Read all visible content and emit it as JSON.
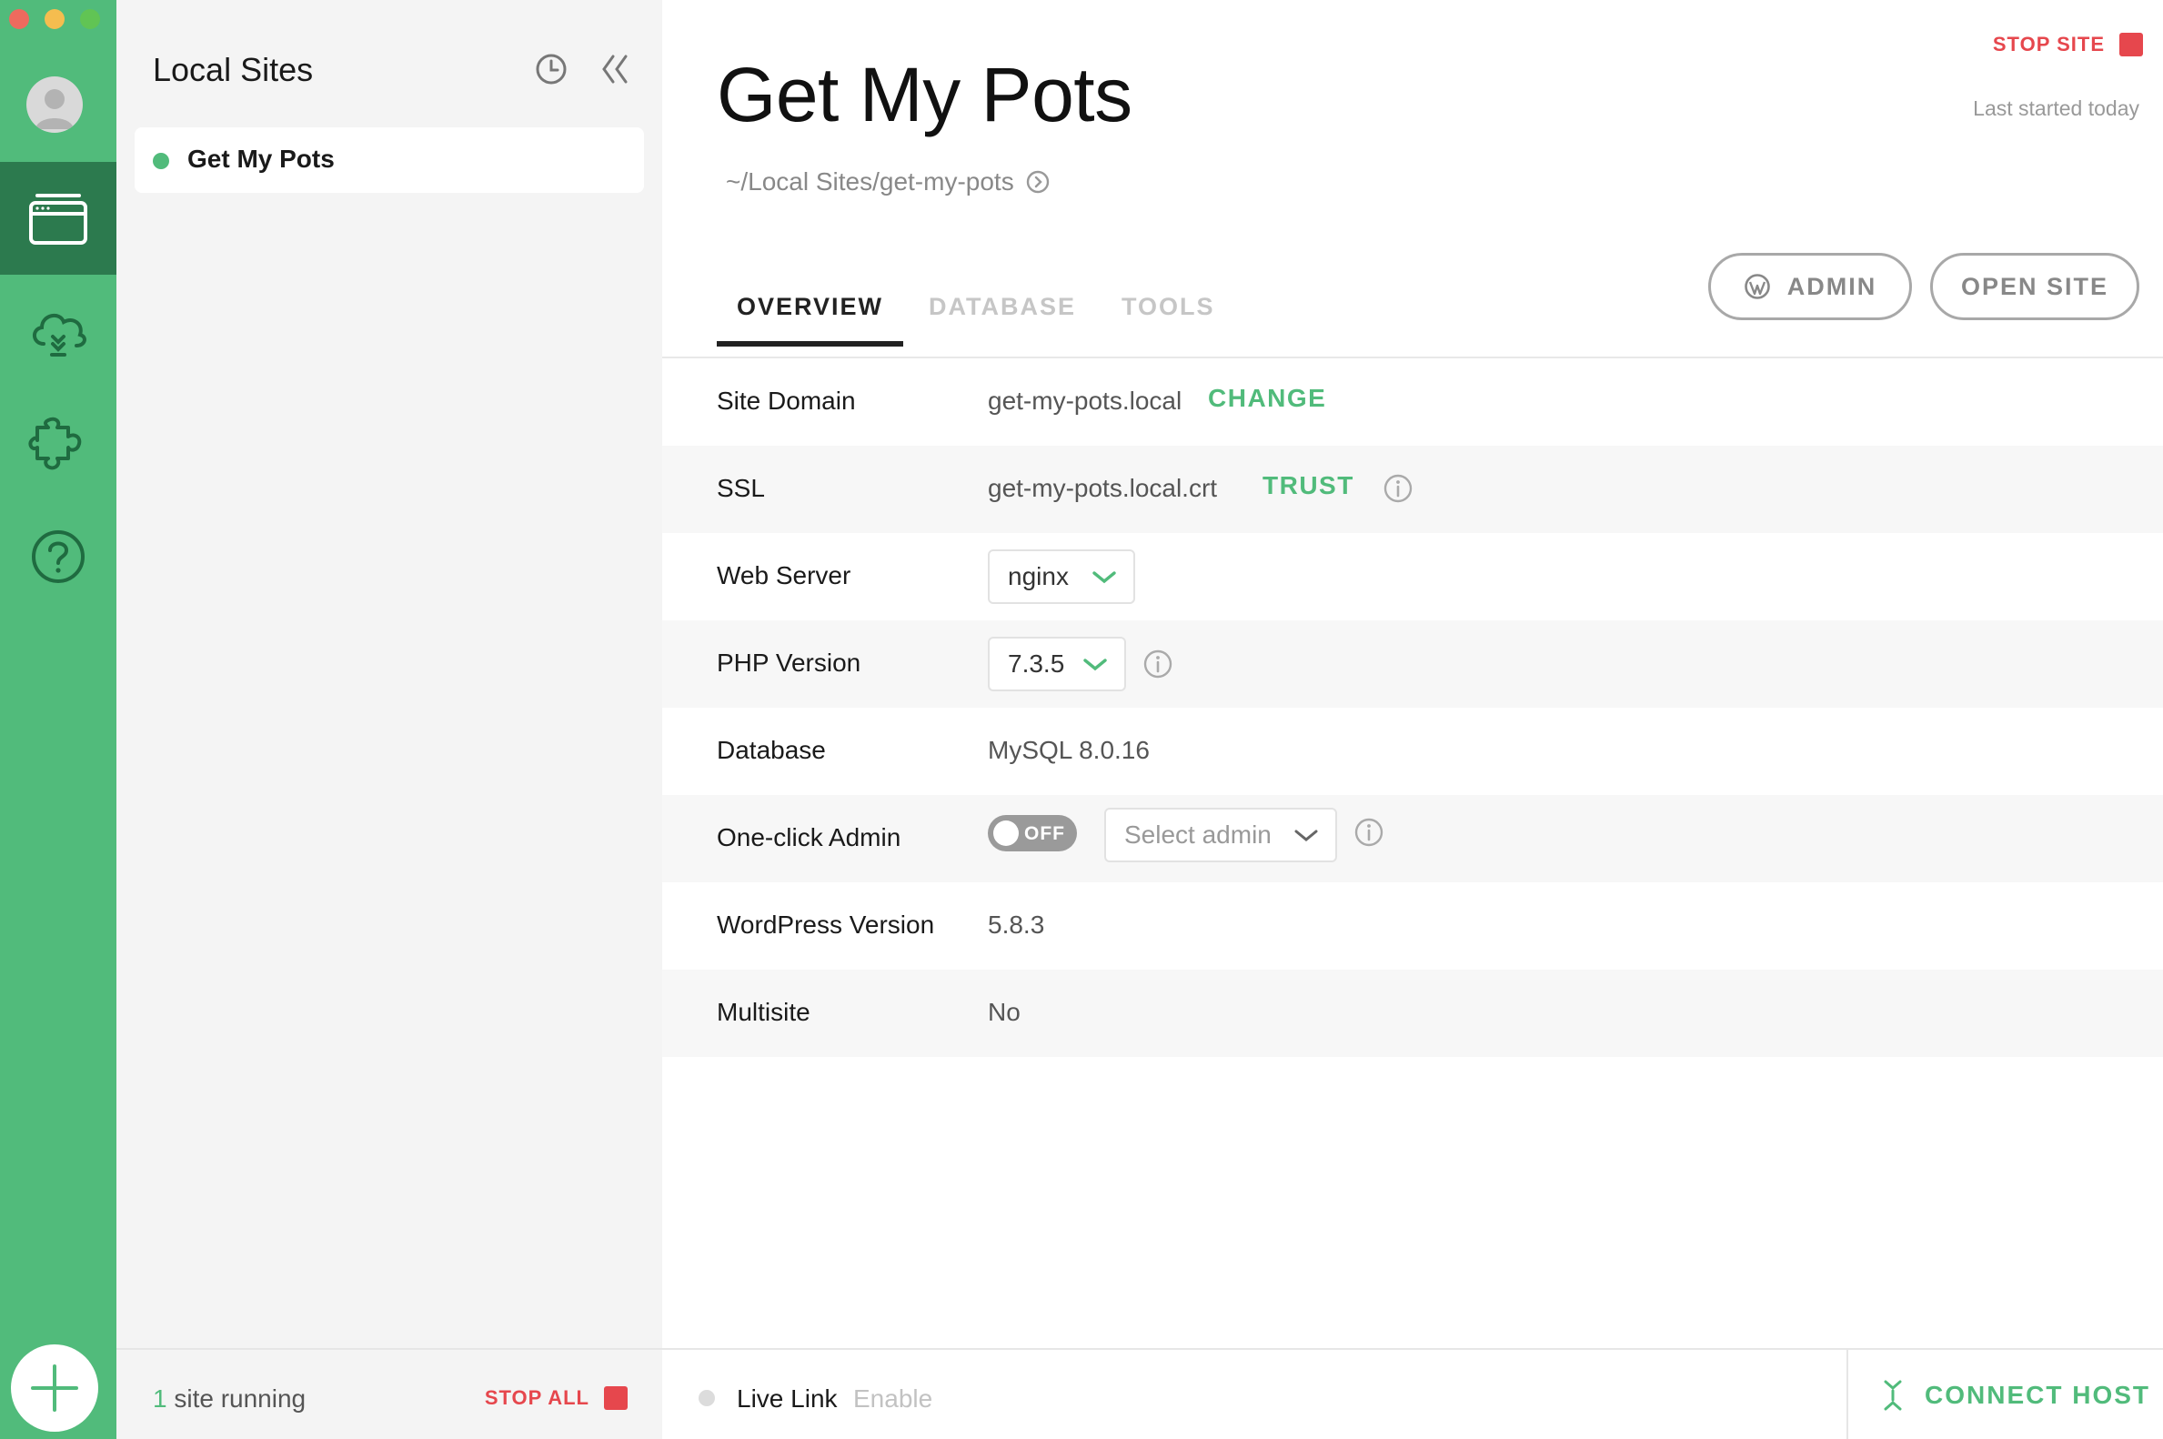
{
  "sidebar": {
    "title": "Local Sites",
    "history_icon": "clock-icon",
    "collapse_icon": "double-chevron-left-icon",
    "sites": [
      {
        "name": "Get My Pots",
        "status": "running"
      }
    ],
    "footer": {
      "count": "1",
      "running_text": "site running",
      "stop_all_label": "STOP ALL"
    }
  },
  "rail": {
    "items": [
      "avatar",
      "sites-icon",
      "cloud-icon",
      "addons-icon",
      "help-icon"
    ],
    "add_icon": "plus-icon"
  },
  "site": {
    "title": "Get My Pots",
    "path": "~/Local Sites/get-my-pots",
    "stop_site_label": "STOP SITE",
    "last_started": "Last started today",
    "admin_label": "ADMIN",
    "open_site_label": "OPEN SITE"
  },
  "tabs": [
    {
      "label": "OVERVIEW",
      "active": true
    },
    {
      "label": "DATABASE",
      "active": false
    },
    {
      "label": "TOOLS",
      "active": false
    }
  ],
  "overview": {
    "site_domain": {
      "label": "Site Domain",
      "value": "get-my-pots.local",
      "action": "CHANGE"
    },
    "ssl": {
      "label": "SSL",
      "value": "get-my-pots.local.crt",
      "action": "TRUST"
    },
    "web_server": {
      "label": "Web Server",
      "value": "nginx"
    },
    "php_version": {
      "label": "PHP Version",
      "value": "7.3.5"
    },
    "database": {
      "label": "Database",
      "value": "MySQL 8.0.16"
    },
    "one_click_admin": {
      "label": "One-click Admin",
      "toggle": "OFF",
      "select_placeholder": "Select admin"
    },
    "wordpress_version": {
      "label": "WordPress Version",
      "value": "5.8.3"
    },
    "multisite": {
      "label": "Multisite",
      "value": "No"
    }
  },
  "footer": {
    "live_link_label": "Live Link",
    "live_link_action": "Enable",
    "connect_host_label": "CONNECT HOST"
  },
  "colors": {
    "brand_green": "#51bb7b",
    "rail_active": "#2c7a4e",
    "stop_red": "#e6474d"
  }
}
